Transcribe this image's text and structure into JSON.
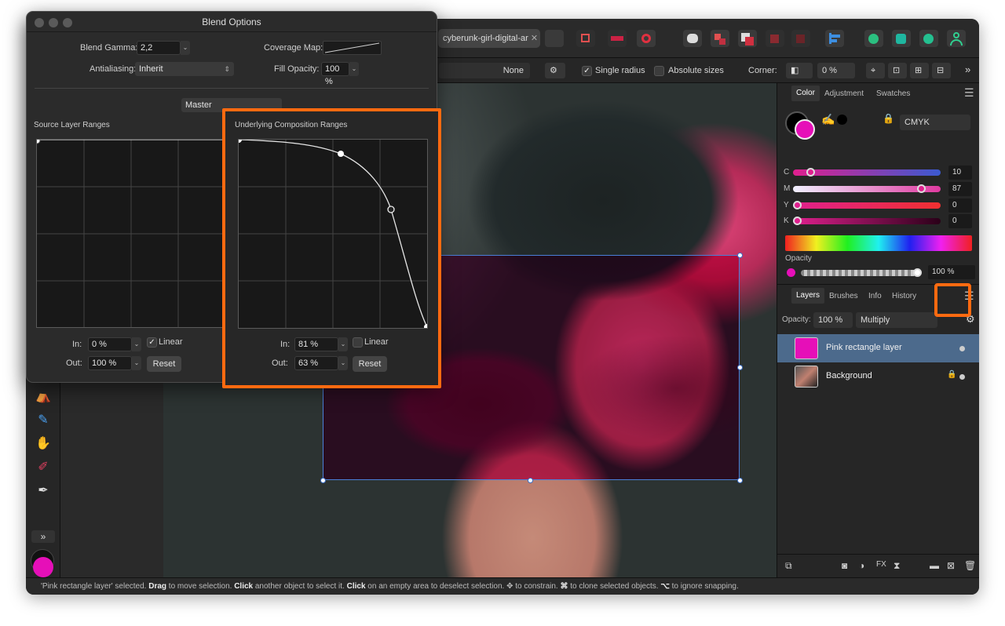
{
  "document": {
    "tab_title": "cyberunk-girl-digital-ar"
  },
  "context_toolbar": {
    "line_style_value": "None",
    "single_radius_label": "Single radius",
    "absolute_sizes_label": "Absolute sizes",
    "corner_label": "Corner:",
    "corner_value": "0 %"
  },
  "color_panel": {
    "tabs": [
      "Color",
      "Adjustment",
      "Swatches"
    ],
    "model": "CMYK",
    "channels": [
      {
        "label": "C",
        "value": "10"
      },
      {
        "label": "M",
        "value": "87"
      },
      {
        "label": "Y",
        "value": "0"
      },
      {
        "label": "K",
        "value": "0"
      }
    ],
    "channel_fraction": [
      0.1,
      0.87,
      0.0,
      0.0
    ],
    "opacity_label": "Opacity",
    "opacity_value": "100 %",
    "accent": "#e6148c"
  },
  "layers_panel": {
    "tabs": [
      "Layers",
      "Brushes",
      "Info",
      "History"
    ],
    "opacity_label": "Opacity:",
    "opacity_value": "100 %",
    "blend_mode": "Multiply",
    "layers": [
      {
        "name": "Pink rectangle layer",
        "selected": true
      },
      {
        "name": "Background",
        "selected": false
      }
    ]
  },
  "status_bar": {
    "p1": "'Pink rectangle layer' selected. ",
    "b1": "Drag",
    "p2": " to move selection. ",
    "b2": "Click",
    "p3": " another object to select it. ",
    "b3": "Click",
    "p4": " on an empty area to deselect selection. ✥ to constrain. ",
    "b4": "⌘",
    "p5": " to clone selected objects. ",
    "b5": "⌥",
    "p6": " to ignore snapping."
  },
  "blend_options": {
    "title": "Blend Options",
    "blend_gamma_label": "Blend Gamma:",
    "blend_gamma_value": "2,2",
    "coverage_map_label": "Coverage Map:",
    "antialiasing_label": "Antialiasing:",
    "antialiasing_value": "Inherit",
    "fill_opacity_label": "Fill Opacity:",
    "fill_opacity_value": "100 %",
    "channel": "Master",
    "source": {
      "title": "Source Layer Ranges",
      "in_label": "In:",
      "in_value": "0 %",
      "out_label": "Out:",
      "out_value": "100 %",
      "linear_label": "Linear",
      "linear_checked": true,
      "reset_label": "Reset"
    },
    "underlying": {
      "title": "Underlying Composition Ranges",
      "in_label": "In:",
      "in_value": "81 %",
      "out_label": "Out:",
      "out_value": "63 %",
      "linear_label": "Linear",
      "linear_checked": false,
      "reset_label": "Reset"
    }
  }
}
